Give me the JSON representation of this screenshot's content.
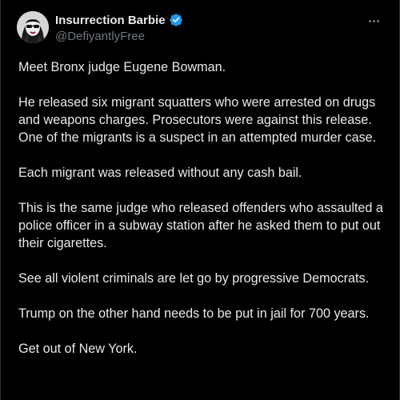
{
  "post": {
    "author": {
      "display_name": "Insurrection Barbie",
      "handle": "@DefiyantlyFree",
      "verified": true,
      "verified_color": "#1d9bf0",
      "avatar_icon": "avatar-icon"
    },
    "more_icon": "more-horizontal-icon",
    "paragraphs": [
      "Meet Bronx judge Eugene Bowman.",
      "He released six migrant squatters who were arrested on drugs and weapons charges. Prosecutors were against this release. One of the migrants is a suspect in an attempted murder case.",
      "Each migrant was released without any cash bail.",
      "This is the same judge who released offenders who assaulted a police officer in a subway station after he asked them to put out their cigarettes.",
      "See all violent criminals are let go by progressive Democrats.",
      "Trump on the other hand needs to be put in jail for 700 years.",
      "Get out of New York."
    ]
  },
  "colors": {
    "background": "#000000",
    "text": "#e7e9ea",
    "secondary_text": "#71767b",
    "border": "#2f3336"
  }
}
